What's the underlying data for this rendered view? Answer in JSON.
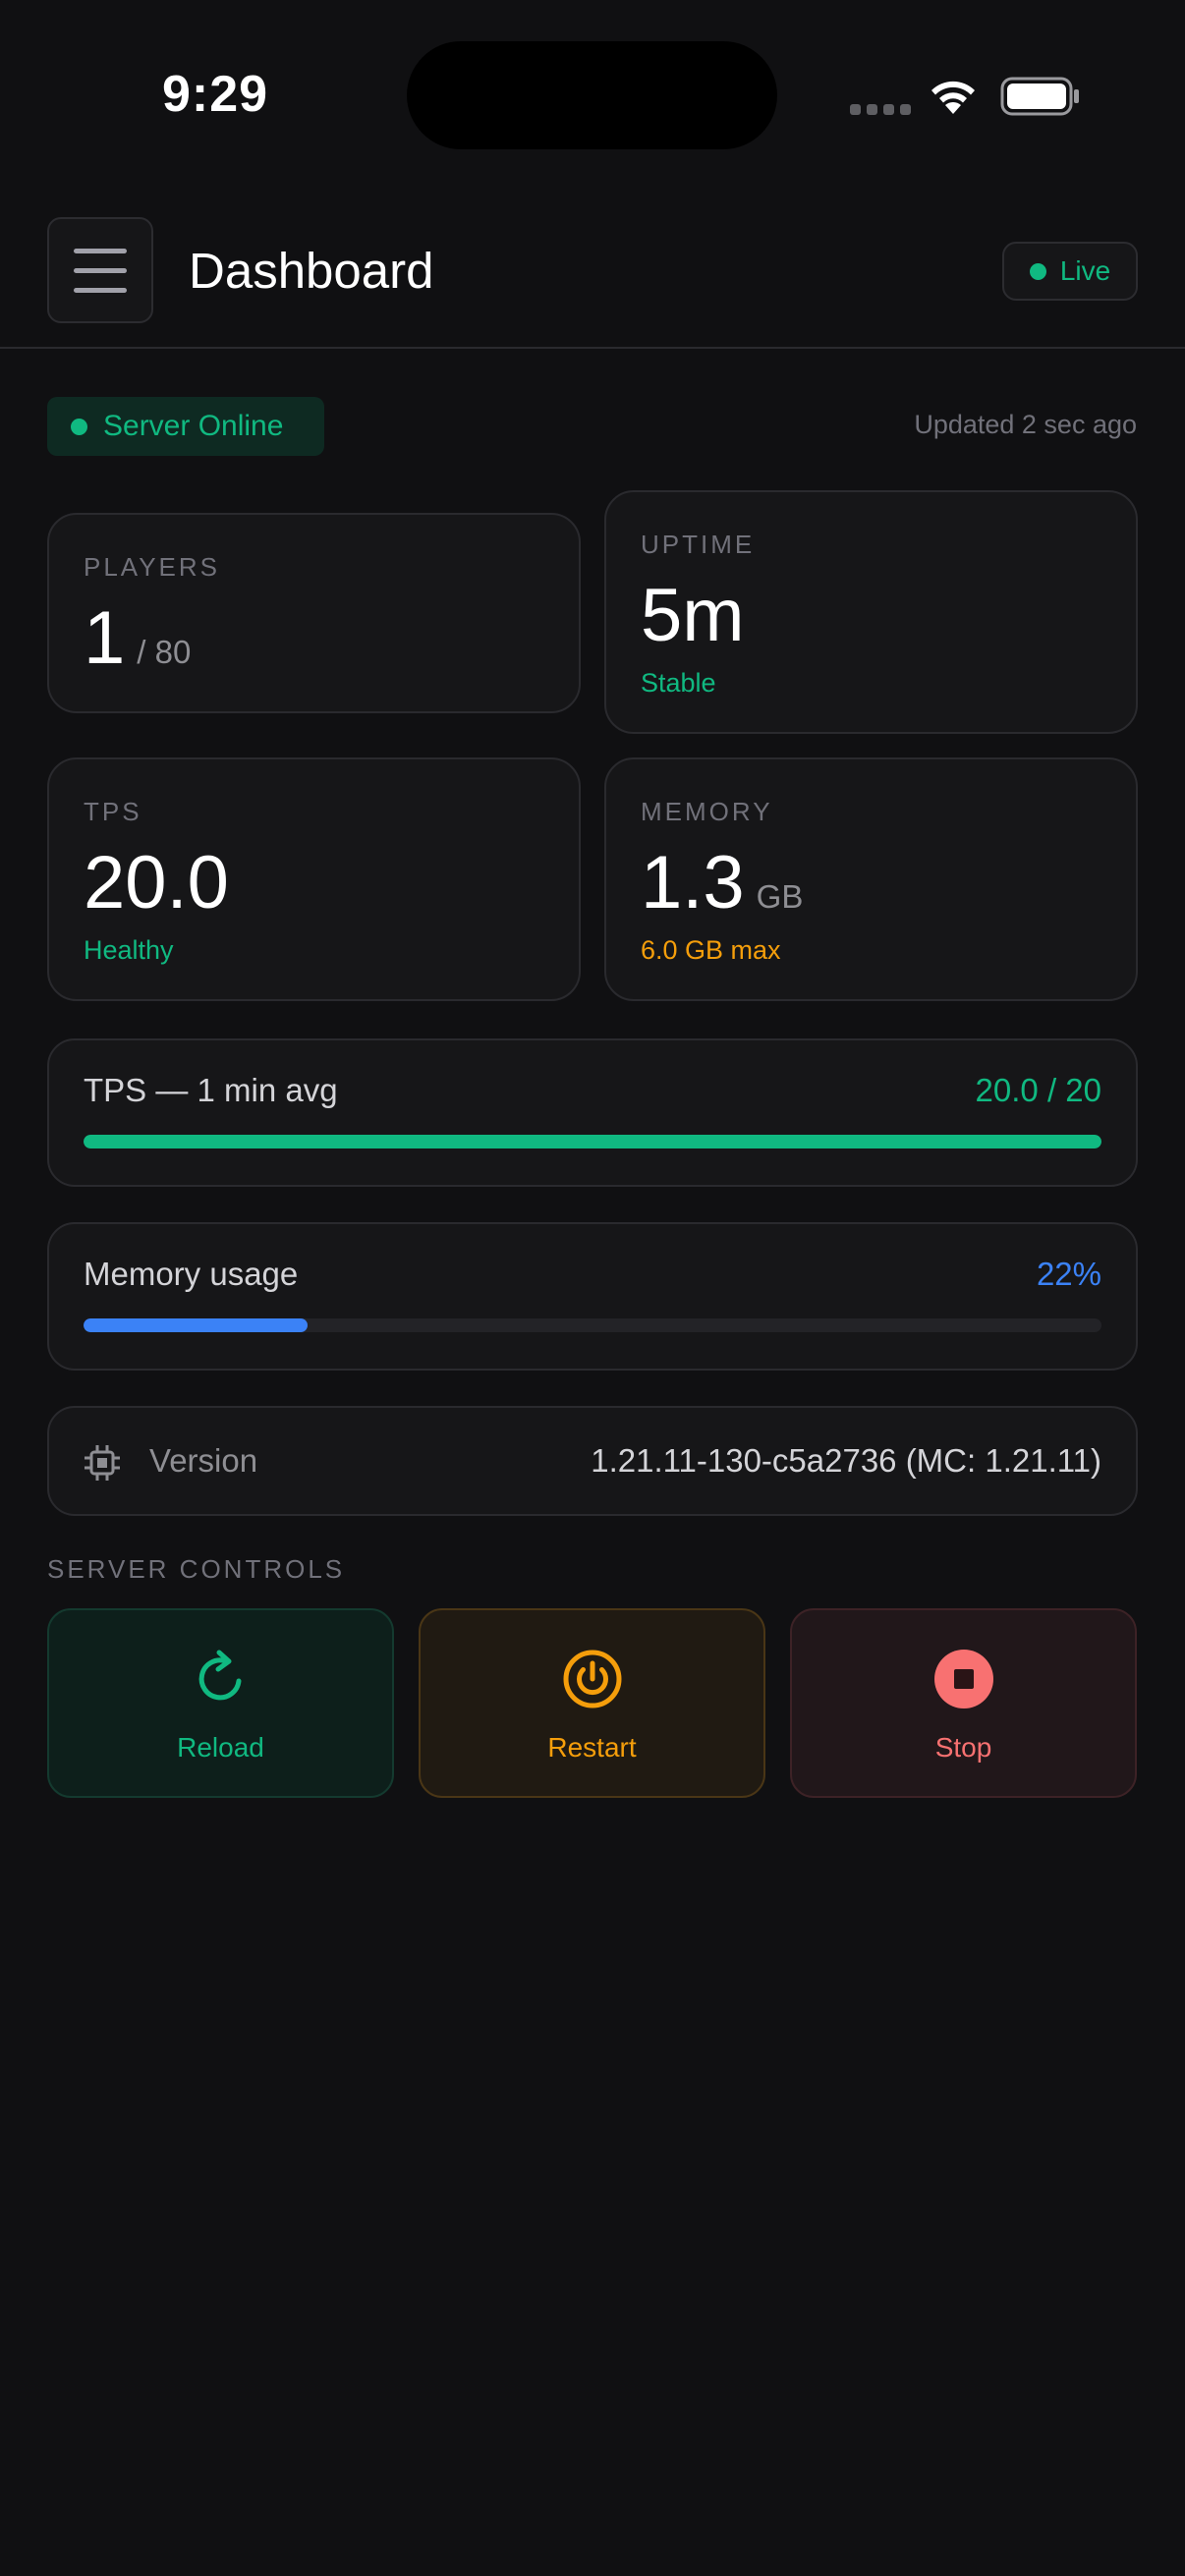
{
  "status_bar": {
    "time": "9:29"
  },
  "header": {
    "title": "Dashboard",
    "live_label": "Live"
  },
  "server_status": {
    "label": "Server Online",
    "updated": "Updated 2 sec ago"
  },
  "stats": {
    "players": {
      "label": "PLAYERS",
      "value": "1",
      "max": "/ 80"
    },
    "uptime": {
      "label": "UPTIME",
      "value": "5m",
      "sub": "Stable"
    },
    "tps": {
      "label": "TPS",
      "value": "20.0",
      "sub": "Healthy"
    },
    "memory": {
      "label": "MEMORY",
      "value": "1.3",
      "unit": "GB",
      "sub": "6.0 GB max"
    }
  },
  "tps_avg": {
    "title": "TPS — 1 min avg",
    "value": "20.0 / 20",
    "fraction": 1.0
  },
  "memory_usage": {
    "title": "Memory usage",
    "value": "22%",
    "fraction": 0.22
  },
  "version": {
    "label": "Version",
    "value": "1.21.11-130-c5a2736 (MC: 1.21.11)",
    "icon": "chip-icon"
  },
  "controls": {
    "title": "SERVER CONTROLS",
    "reload": "Reload",
    "restart": "Restart",
    "stop": "Stop"
  },
  "colors": {
    "background": "#101012",
    "card": "#161618",
    "green": "#10b981",
    "blue": "#3b82f6",
    "amber": "#f59e0b",
    "red": "#f87171"
  }
}
